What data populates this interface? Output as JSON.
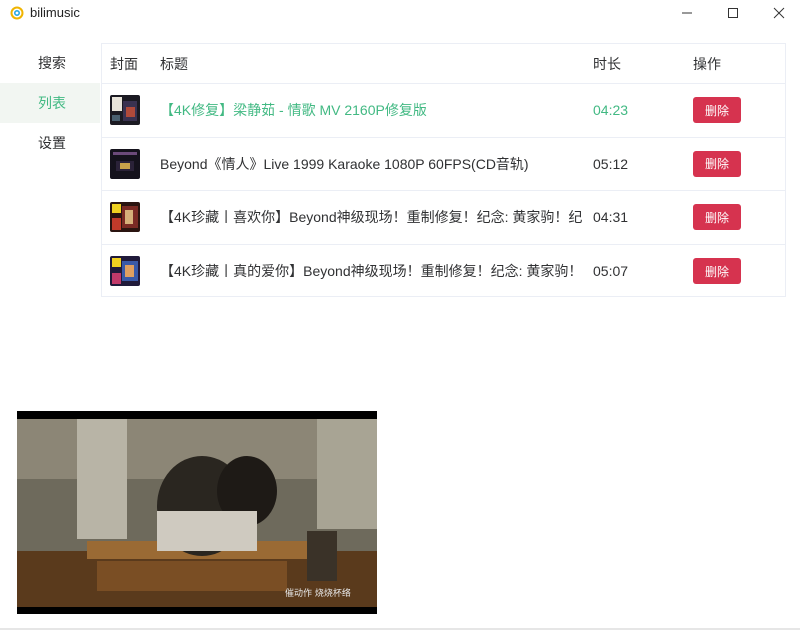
{
  "app": {
    "title": "bilimusic"
  },
  "sidebar": {
    "items": [
      {
        "label": "搜索",
        "active": false
      },
      {
        "label": "列表",
        "active": true
      },
      {
        "label": "设置",
        "active": false
      }
    ]
  },
  "table": {
    "headers": {
      "cover": "封面",
      "title": "标题",
      "duration": "时长",
      "actions": "操作"
    },
    "rows": [
      {
        "title": "【4K修复】梁静茹 - 情歌 MV 2160P修复版",
        "duration": "04:23",
        "delete_label": "删除",
        "playing": true
      },
      {
        "title": "Beyond《情人》Live 1999 Karaoke 1080P 60FPS(CD音轨)",
        "duration": "05:12",
        "delete_label": "删除",
        "playing": false
      },
      {
        "title": "【4K珍藏丨喜欢你】Beyond神级现场！重制修复！纪念: 黄家驹！纪",
        "duration": "04:31",
        "delete_label": "删除",
        "playing": false
      },
      {
        "title": "【4K珍藏丨真的爱你】Beyond神级现场！重制修复！纪念: 黄家驹！",
        "duration": "05:07",
        "delete_label": "删除",
        "playing": false
      }
    ]
  },
  "player": {
    "subtitle": "催动作 烧烧杯络"
  },
  "colors": {
    "accent": "#42b983",
    "danger": "#d6334f",
    "border": "#ebeef5"
  }
}
